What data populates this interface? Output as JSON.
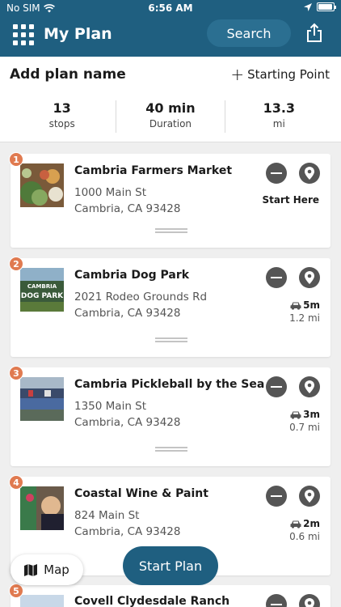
{
  "status": {
    "carrier": "No SIM",
    "time": "6:56 AM"
  },
  "nav": {
    "title": "My Plan",
    "search_label": "Search"
  },
  "plan": {
    "name_placeholder": "Add plan name",
    "starting_point_label": "Starting Point"
  },
  "stats": [
    {
      "value": "13",
      "label": "stops"
    },
    {
      "value": "40 min",
      "label": "Duration"
    },
    {
      "value": "13.3",
      "label": "mi"
    }
  ],
  "stops": [
    {
      "number": "1",
      "name": "Cambria Farmers Market",
      "address1": "1000 Main St",
      "address2": "Cambria, CA 93428",
      "start_label": "Start Here"
    },
    {
      "number": "2",
      "name": "Cambria Dog Park",
      "address1": "2021 Rodeo Grounds Rd",
      "address2": "Cambria, CA 93428",
      "drive_time": "5m",
      "distance": "1.2 mi",
      "sign_text_top": "CAMBRIA",
      "sign_text_bottom": "DOG PARK"
    },
    {
      "number": "3",
      "name": "Cambria Pickleball by the Sea",
      "address1": "1350 Main St",
      "address2": "Cambria, CA 93428",
      "drive_time": "3m",
      "distance": "0.7 mi"
    },
    {
      "number": "4",
      "name": "Coastal Wine & Paint",
      "address1": "824 Main St",
      "address2": "Cambria, CA 93428",
      "drive_time": "2m",
      "distance": "0.6 mi"
    },
    {
      "number": "5",
      "name": "Covell Clydesdale Ranch"
    }
  ],
  "buttons": {
    "map_label": "Map",
    "start_plan_label": "Start Plan"
  },
  "icons": {
    "menu": "grid-menu-icon",
    "share": "share-icon",
    "remove": "minus-circle-icon",
    "pin": "map-pin-icon",
    "car": "car-icon",
    "map": "map-icon"
  },
  "colors": {
    "primary": "#1f5f80",
    "badge": "#e07a50"
  }
}
